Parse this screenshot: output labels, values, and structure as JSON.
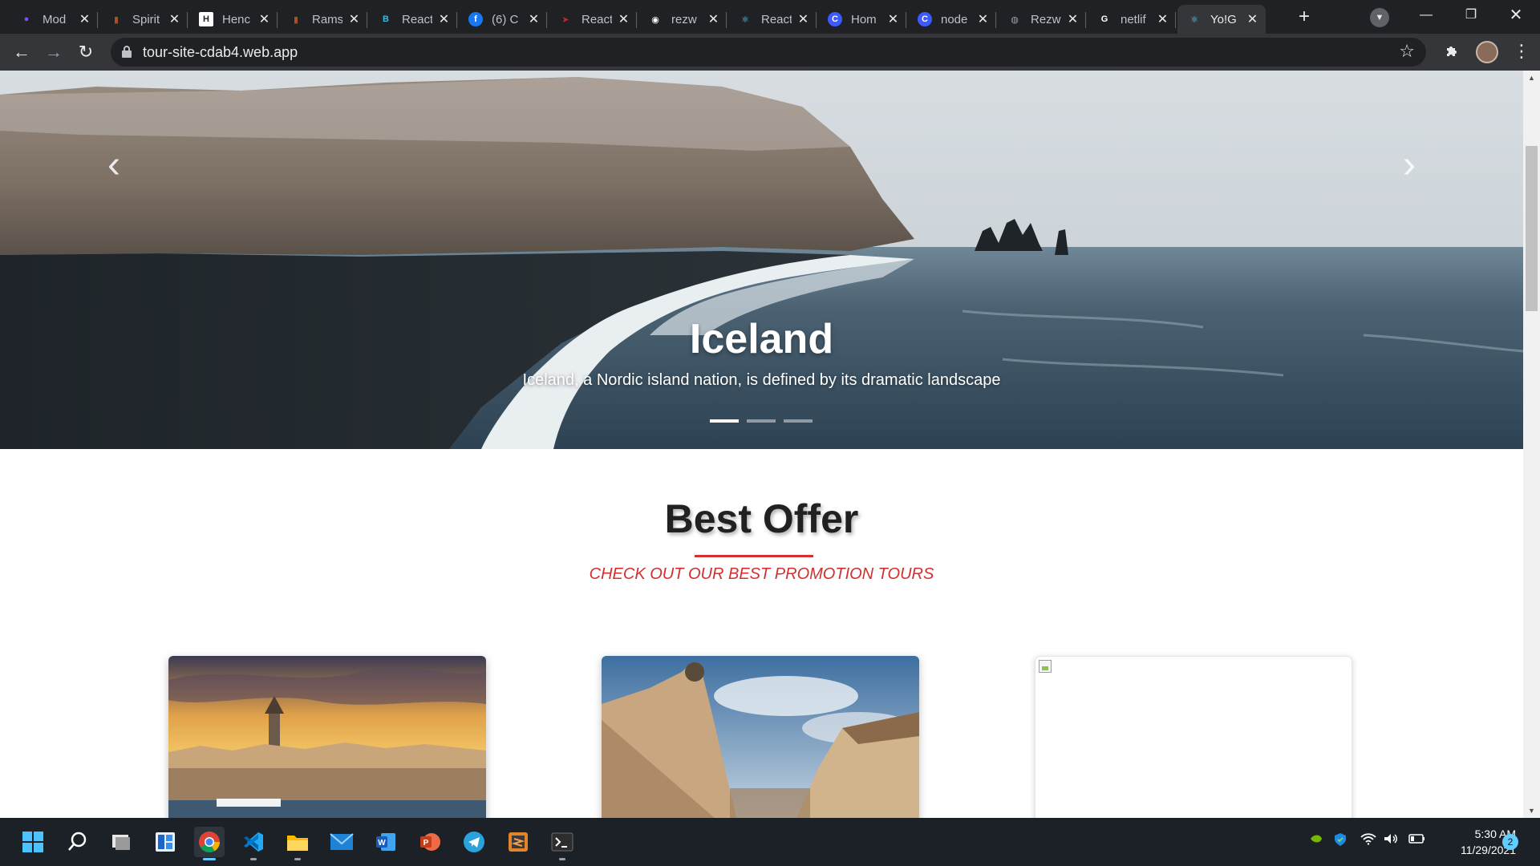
{
  "browser": {
    "tabs": [
      {
        "title": "Mod",
        "favicon": "colorful-drop-icon",
        "color": "#7c4dff"
      },
      {
        "title": "Spirit",
        "favicon": "book-icon",
        "color": "#a0522d"
      },
      {
        "title": "Henc",
        "favicon": "letter-h-icon",
        "color": "#ffffff"
      },
      {
        "title": "Rams",
        "favicon": "book-icon",
        "color": "#a0522d"
      },
      {
        "title": "React",
        "favicon": "bootstrap-icon",
        "color": "#3fb8e0"
      },
      {
        "title": "(6) C",
        "favicon": "facebook-icon",
        "color": "#1877f2"
      },
      {
        "title": "React",
        "favicon": "red-arrow-icon",
        "color": "#c62828"
      },
      {
        "title": "rezw",
        "favicon": "github-icon",
        "color": "#ffffff"
      },
      {
        "title": "React",
        "favicon": "react-icon",
        "color": "#61dafb"
      },
      {
        "title": "Hom",
        "favicon": "letter-c-icon",
        "color": "#3d5afe"
      },
      {
        "title": "node",
        "favicon": "letter-c-icon",
        "color": "#3d5afe"
      },
      {
        "title": "Rezw",
        "favicon": "globe-icon",
        "color": "#9aa0a6"
      },
      {
        "title": "netlif",
        "favicon": "google-icon",
        "color": "#ffffff"
      },
      {
        "title": "Yo!G",
        "favicon": "react-icon",
        "color": "#61dafb",
        "active": true
      }
    ],
    "url": "tour-site-cdab4.web.app"
  },
  "hero": {
    "title": "Iceland",
    "subtitle": "Iceland, a Nordic island nation, is defined by its dramatic landscape",
    "slides": 3,
    "active_slide": 1
  },
  "offer": {
    "title": "Best Offer",
    "subtitle": "CHECK OUT OUR BEST PROMOTION TOURS",
    "accent": "#d32f2f"
  },
  "taskbar": {
    "apps": [
      "windows-start-icon",
      "search-icon",
      "task-view-icon",
      "widgets-icon",
      "chrome-icon",
      "vscode-icon",
      "file-explorer-icon",
      "mail-icon",
      "word-icon",
      "powerpoint-icon",
      "telegram-icon",
      "sublime-icon",
      "terminal-icon"
    ],
    "time": "5:30 AM",
    "date": "11/29/2021",
    "notifications": "2"
  }
}
